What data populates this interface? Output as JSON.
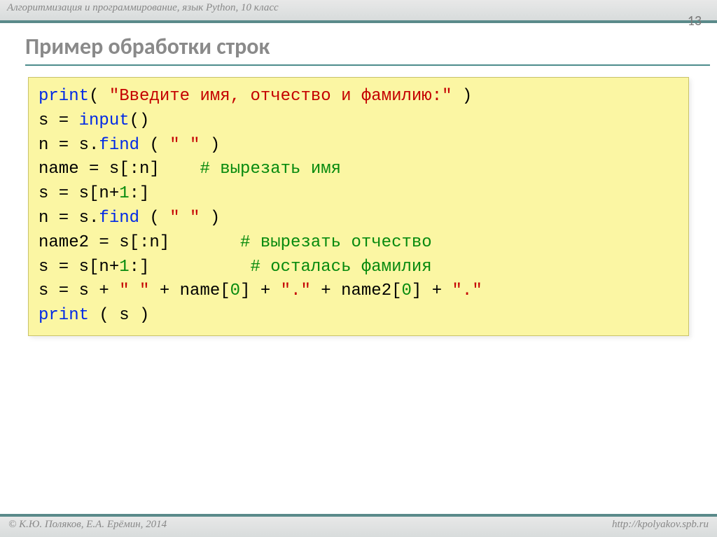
{
  "header": {
    "subject": "Алгоритмизация и программирование, язык Python, 10 класс",
    "page_number": "13"
  },
  "title": "Пример обработки строк",
  "code": {
    "l1": {
      "kw": "print",
      "rest": "( ",
      "str": "\"Введите имя, отчество и фамилию:\"",
      "close": " )"
    },
    "l2": {
      "pre": "s = ",
      "fn": "input",
      "post": "()"
    },
    "l3": {
      "pre": "n = s.",
      "fn": "find",
      "open": " ( ",
      "str": "\" \"",
      "close": " )"
    },
    "l4": {
      "pre": "name = s[:n]    ",
      "cmt": "# вырезать имя"
    },
    "l5": {
      "pre": "s = s[n+",
      "num": "1",
      "post": ":]"
    },
    "l6": {
      "pre": "n = s.",
      "fn": "find",
      "open": " ( ",
      "str": "\" \"",
      "close": " )"
    },
    "l7": {
      "pre": "name2 = s[:n]       ",
      "cmt": "# вырезать отчество"
    },
    "l8": {
      "pre": "s = s[n+",
      "num": "1",
      "post": ":]          ",
      "cmt": "# осталась фамилия"
    },
    "l9": {
      "a": "s = s + ",
      "s1": "\" \"",
      "b": " + name[",
      "n1": "0",
      "c": "] + ",
      "s2": "\".\"",
      "d": " + name2[",
      "n2": "0",
      "e": "] + ",
      "s3": "\".\""
    },
    "l10": {
      "kw": "print",
      "rest": " ( s )"
    }
  },
  "footer": {
    "left": "© К.Ю. Поляков, Е.А. Ерёмин, 2014",
    "right": "http://kpolyakov.spb.ru"
  }
}
